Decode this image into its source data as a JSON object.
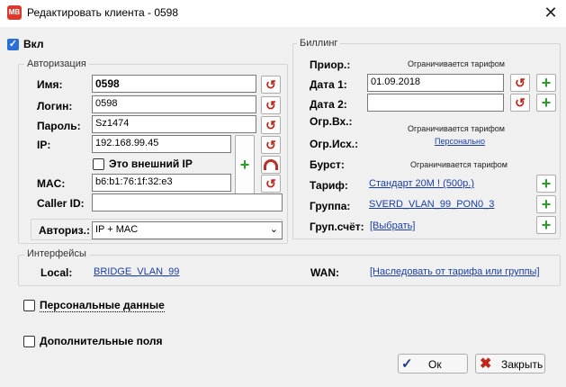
{
  "window": {
    "title": "Редактировать клиента - 0598",
    "icon_text": "МВ"
  },
  "enabled": {
    "label": "Вкл",
    "checked": true
  },
  "auth": {
    "legend": "Авторизация",
    "name_label": "Имя:",
    "name_value": "0598",
    "login_label": "Логин:",
    "login_value": "0598",
    "password_label": "Пароль:",
    "password_value": "Sz1474",
    "ip_label": "IP:",
    "ip_value": "192.168.99.45",
    "external_ip_label": "Это внешний IP",
    "mac_label": "MAC:",
    "mac_value": "b6:b1:76:1f:32:e3",
    "callerid_label": "Caller ID:",
    "callerid_value": "",
    "authtype_label": "Авториз.:",
    "authtype_value": "IP + MAC"
  },
  "billing": {
    "legend": "Биллинг",
    "prior_label": "Приор.:",
    "prior_hint": "Ограничивается тарифом",
    "date1_label": "Дата 1:",
    "date1_value": "01.09.2018",
    "date2_label": "Дата 2:",
    "date2_value": "",
    "ogr_in_label": "Огр.Вх.:",
    "ogr_in_hint": "Ограничивается тарифом",
    "ogr_out_label": "Огр.Исх.:",
    "ogr_out_link": "Персонально",
    "burst_label": "Бурст:",
    "burst_hint": "Ограничивается тарифом",
    "tariff_label": "Тариф:",
    "tariff_link": "Стандарт 20М ! (500р.)",
    "group_label": "Группа:",
    "group_link": "SVERD_VLAN_99_PON0_3",
    "group_account_label": "Груп.счёт:",
    "group_account_link": "[Выбрать]"
  },
  "interfaces": {
    "legend": "Интерфейсы",
    "local_label": "Local:",
    "local_link": "BRIDGE_VLAN_99",
    "wan_label": "WAN:",
    "wan_link": "[Наследовать от тарифа или группы]"
  },
  "personal_data": {
    "label": "Персональные данные",
    "checked": false
  },
  "extra_fields": {
    "label": "Дополнительные поля",
    "checked": false
  },
  "buttons": {
    "ok": "Ок",
    "close": "Закрыть"
  },
  "colors": {
    "link": "#1a3ea8",
    "plus": "#2c9a2c",
    "reset": "#c0271b",
    "accent": "#2a6fd6"
  }
}
